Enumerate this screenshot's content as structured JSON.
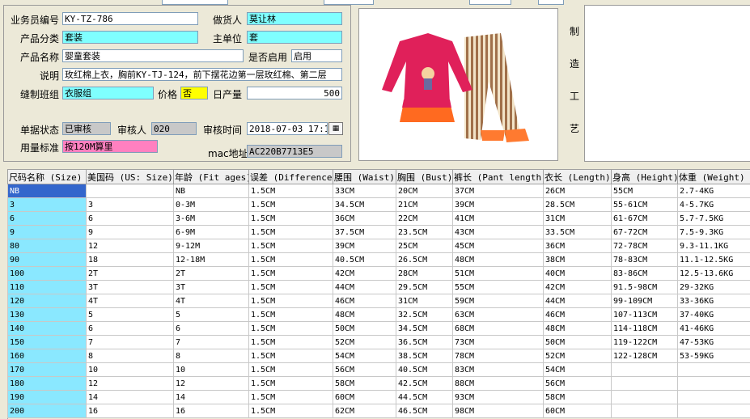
{
  "form": {
    "salesman_no_label": "业务员编号",
    "salesman_no": "KY-TZ-786",
    "maker_label": "做货人",
    "maker": "莫让林",
    "category_label": "产品分类",
    "category": "套装",
    "unit_label": "主单位",
    "unit": "套",
    "product_name_label": "产品名称",
    "product_name": "婴童套装",
    "enabled_label": "是否启用",
    "enabled": "启用",
    "desc_label": "说明",
    "desc": "玫红棉上衣，胸前KY-TJ-124，前下摆花边第一层玫红棉、第二层",
    "sewing_group_label": "缝制班组",
    "sewing_group": "衣服组",
    "price_label": "价格",
    "price": "否",
    "daily_output_label": "日产量",
    "daily_output": "500",
    "status_label": "单据状态",
    "status": "已审核",
    "auditor_label": "审核人",
    "auditor": "020",
    "audit_time_label": "审核时间",
    "audit_time": "2018-07-03  17:1",
    "usage_label": "用量标准",
    "usage": "按120M算里",
    "mac_label": "mac地址",
    "mac": "AC220B7713E5"
  },
  "side_label": [
    "制",
    "造",
    "工",
    "艺"
  ],
  "table": {
    "headers": [
      "尺码名称 (Size)",
      "美国码 (US: Size)",
      "年龄 (Fit ages)",
      "误差 (Difference)",
      "腰围 (Waist)",
      "胸围 (Bust)",
      "裤长 (Pant length)",
      "衣长 (Length)",
      "身高 (Height)",
      "体重 (Weight)"
    ],
    "rows": [
      [
        "NB",
        "",
        "NB",
        "1.5CM",
        "33CM",
        "20CM",
        "37CM",
        "26CM",
        "55CM",
        "2.7-4KG"
      ],
      [
        "3",
        "3",
        "0-3M",
        "1.5CM",
        "34.5CM",
        "21CM",
        "39CM",
        "28.5CM",
        "55-61CM",
        "4-5.7KG"
      ],
      [
        "6",
        "6",
        "3-6M",
        "1.5CM",
        "36CM",
        "22CM",
        "41CM",
        "31CM",
        "61-67CM",
        "5.7-7.5KG"
      ],
      [
        "9",
        "9",
        "6-9M",
        "1.5CM",
        "37.5CM",
        "23.5CM",
        "43CM",
        "33.5CM",
        "67-72CM",
        "7.5-9.3KG"
      ],
      [
        "80",
        "12",
        "9-12M",
        "1.5CM",
        "39CM",
        "25CM",
        "45CM",
        "36CM",
        "72-78CM",
        "9.3-11.1KG"
      ],
      [
        "90",
        "18",
        "12-18M",
        "1.5CM",
        "40.5CM",
        "26.5CM",
        "48CM",
        "38CM",
        "78-83CM",
        "11.1-12.5KG"
      ],
      [
        "100",
        "2T",
        "2T",
        "1.5CM",
        "42CM",
        "28CM",
        "51CM",
        "40CM",
        "83-86CM",
        "12.5-13.6KG"
      ],
      [
        "110",
        "3T",
        "3T",
        "1.5CM",
        "44CM",
        "29.5CM",
        "55CM",
        "42CM",
        "91.5-98CM",
        "29-32KG"
      ],
      [
        "120",
        "4T",
        "4T",
        "1.5CM",
        "46CM",
        "31CM",
        "59CM",
        "44CM",
        "99-109CM",
        "33-36KG"
      ],
      [
        "130",
        "5",
        "5",
        "1.5CM",
        "48CM",
        "32.5CM",
        "63CM",
        "46CM",
        "107-113CM",
        "37-40KG"
      ],
      [
        "140",
        "6",
        "6",
        "1.5CM",
        "50CM",
        "34.5CM",
        "68CM",
        "48CM",
        "114-118CM",
        "41-46KG"
      ],
      [
        "150",
        "7",
        "7",
        "1.5CM",
        "52CM",
        "36.5CM",
        "73CM",
        "50CM",
        "119-122CM",
        "47-53KG"
      ],
      [
        "160",
        "8",
        "8",
        "1.5CM",
        "54CM",
        "38.5CM",
        "78CM",
        "52CM",
        "122-128CM",
        "53-59KG"
      ],
      [
        "170",
        "10",
        "10",
        "1.5CM",
        "56CM",
        "40.5CM",
        "83CM",
        "54CM",
        "",
        ""
      ],
      [
        "180",
        "12",
        "12",
        "1.5CM",
        "58CM",
        "42.5CM",
        "88CM",
        "56CM",
        "",
        ""
      ],
      [
        "190",
        "14",
        "14",
        "1.5CM",
        "60CM",
        "44.5CM",
        "93CM",
        "58CM",
        "",
        ""
      ],
      [
        "200",
        "16",
        "16",
        "1.5CM",
        "62CM",
        "46.5CM",
        "98CM",
        "60CM",
        "",
        ""
      ]
    ]
  }
}
